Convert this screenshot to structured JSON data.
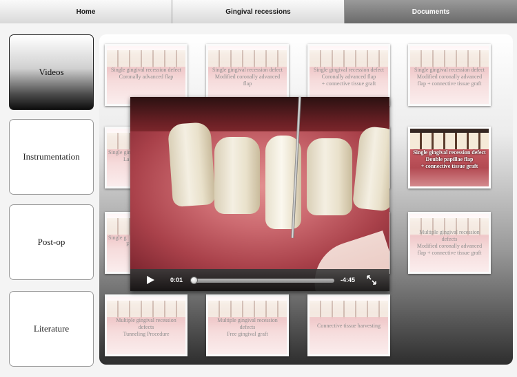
{
  "tabs": [
    {
      "label": "Home"
    },
    {
      "label": "Gingival recessions"
    },
    {
      "label": "Documents",
      "active": true
    }
  ],
  "sidebar": {
    "items": [
      {
        "label": "Videos",
        "active": true
      },
      {
        "label": "Instrumentation"
      },
      {
        "label": "Post-op"
      },
      {
        "label": "Literature"
      }
    ]
  },
  "thumbnails": [
    {
      "line1": "Single gingival recession defect",
      "line2": "Coronally advanced flap",
      "line3": ""
    },
    {
      "line1": "Single gingival recession defect",
      "line2": "Modified coronally advanced",
      "line3": "flap"
    },
    {
      "line1": "Single gingival recession defect",
      "line2": "Coronally advanced flap",
      "line3": "+ connective tissue graft"
    },
    {
      "line1": "Single gingival recession defect",
      "line2": "Modified coronally advanced",
      "line3": "flap + connective tissue graft"
    },
    {
      "line1": "Single gingival",
      "line2": "La",
      "line3": ""
    },
    {
      "line1": "Single gingival recession defect",
      "line2": "Double papillae flap",
      "line3": "+ connective tissue graft",
      "selected": true
    },
    {
      "line1": "Single g",
      "line2": "F",
      "line3": ""
    },
    {
      "line1": "Multiple gingival recession",
      "line2": "defects",
      "line3": "Modified coronally advanced",
      "line4": "flap + connective tissue graft"
    },
    {
      "line1": "Multiple gingival recession",
      "line2": "defects",
      "line3": "Tunneling Procedure"
    },
    {
      "line1": "Multiple gingival recession",
      "line2": "defects",
      "line3": "Free gingival graft"
    },
    {
      "line1": "Connective tissue harvesting",
      "line2": "",
      "line3": ""
    }
  ],
  "player": {
    "elapsed": "0:01",
    "remaining": "-4:45",
    "progress": 0.0035
  },
  "icons": {
    "play": "play-icon",
    "fullscreen": "fullscreen-icon"
  },
  "colors": {
    "active_tab": "#7a7a7a",
    "gum": "#c55a62"
  }
}
